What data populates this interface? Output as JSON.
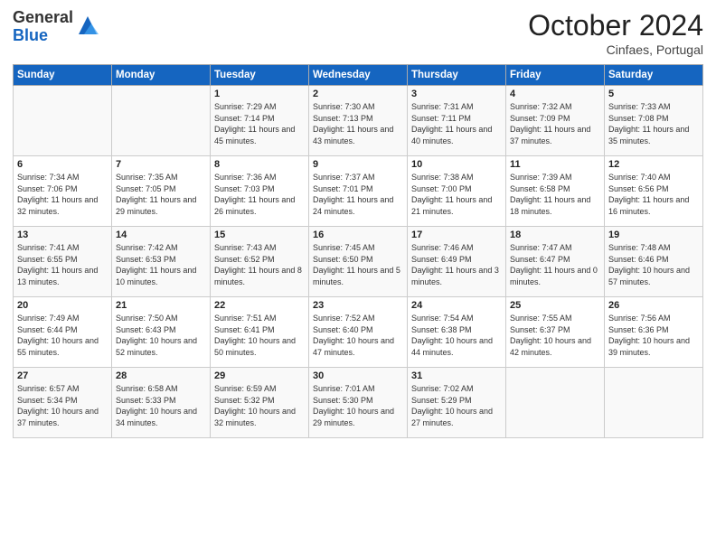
{
  "logo": {
    "general": "General",
    "blue": "Blue"
  },
  "title": "October 2024",
  "subtitle": "Cinfaes, Portugal",
  "days_header": [
    "Sunday",
    "Monday",
    "Tuesday",
    "Wednesday",
    "Thursday",
    "Friday",
    "Saturday"
  ],
  "weeks": [
    [
      {
        "day": "",
        "sunrise": "",
        "sunset": "",
        "daylight": ""
      },
      {
        "day": "",
        "sunrise": "",
        "sunset": "",
        "daylight": ""
      },
      {
        "day": "1",
        "sunrise": "Sunrise: 7:29 AM",
        "sunset": "Sunset: 7:14 PM",
        "daylight": "Daylight: 11 hours and 45 minutes."
      },
      {
        "day": "2",
        "sunrise": "Sunrise: 7:30 AM",
        "sunset": "Sunset: 7:13 PM",
        "daylight": "Daylight: 11 hours and 43 minutes."
      },
      {
        "day": "3",
        "sunrise": "Sunrise: 7:31 AM",
        "sunset": "Sunset: 7:11 PM",
        "daylight": "Daylight: 11 hours and 40 minutes."
      },
      {
        "day": "4",
        "sunrise": "Sunrise: 7:32 AM",
        "sunset": "Sunset: 7:09 PM",
        "daylight": "Daylight: 11 hours and 37 minutes."
      },
      {
        "day": "5",
        "sunrise": "Sunrise: 7:33 AM",
        "sunset": "Sunset: 7:08 PM",
        "daylight": "Daylight: 11 hours and 35 minutes."
      }
    ],
    [
      {
        "day": "6",
        "sunrise": "Sunrise: 7:34 AM",
        "sunset": "Sunset: 7:06 PM",
        "daylight": "Daylight: 11 hours and 32 minutes."
      },
      {
        "day": "7",
        "sunrise": "Sunrise: 7:35 AM",
        "sunset": "Sunset: 7:05 PM",
        "daylight": "Daylight: 11 hours and 29 minutes."
      },
      {
        "day": "8",
        "sunrise": "Sunrise: 7:36 AM",
        "sunset": "Sunset: 7:03 PM",
        "daylight": "Daylight: 11 hours and 26 minutes."
      },
      {
        "day": "9",
        "sunrise": "Sunrise: 7:37 AM",
        "sunset": "Sunset: 7:01 PM",
        "daylight": "Daylight: 11 hours and 24 minutes."
      },
      {
        "day": "10",
        "sunrise": "Sunrise: 7:38 AM",
        "sunset": "Sunset: 7:00 PM",
        "daylight": "Daylight: 11 hours and 21 minutes."
      },
      {
        "day": "11",
        "sunrise": "Sunrise: 7:39 AM",
        "sunset": "Sunset: 6:58 PM",
        "daylight": "Daylight: 11 hours and 18 minutes."
      },
      {
        "day": "12",
        "sunrise": "Sunrise: 7:40 AM",
        "sunset": "Sunset: 6:56 PM",
        "daylight": "Daylight: 11 hours and 16 minutes."
      }
    ],
    [
      {
        "day": "13",
        "sunrise": "Sunrise: 7:41 AM",
        "sunset": "Sunset: 6:55 PM",
        "daylight": "Daylight: 11 hours and 13 minutes."
      },
      {
        "day": "14",
        "sunrise": "Sunrise: 7:42 AM",
        "sunset": "Sunset: 6:53 PM",
        "daylight": "Daylight: 11 hours and 10 minutes."
      },
      {
        "day": "15",
        "sunrise": "Sunrise: 7:43 AM",
        "sunset": "Sunset: 6:52 PM",
        "daylight": "Daylight: 11 hours and 8 minutes."
      },
      {
        "day": "16",
        "sunrise": "Sunrise: 7:45 AM",
        "sunset": "Sunset: 6:50 PM",
        "daylight": "Daylight: 11 hours and 5 minutes."
      },
      {
        "day": "17",
        "sunrise": "Sunrise: 7:46 AM",
        "sunset": "Sunset: 6:49 PM",
        "daylight": "Daylight: 11 hours and 3 minutes."
      },
      {
        "day": "18",
        "sunrise": "Sunrise: 7:47 AM",
        "sunset": "Sunset: 6:47 PM",
        "daylight": "Daylight: 11 hours and 0 minutes."
      },
      {
        "day": "19",
        "sunrise": "Sunrise: 7:48 AM",
        "sunset": "Sunset: 6:46 PM",
        "daylight": "Daylight: 10 hours and 57 minutes."
      }
    ],
    [
      {
        "day": "20",
        "sunrise": "Sunrise: 7:49 AM",
        "sunset": "Sunset: 6:44 PM",
        "daylight": "Daylight: 10 hours and 55 minutes."
      },
      {
        "day": "21",
        "sunrise": "Sunrise: 7:50 AM",
        "sunset": "Sunset: 6:43 PM",
        "daylight": "Daylight: 10 hours and 52 minutes."
      },
      {
        "day": "22",
        "sunrise": "Sunrise: 7:51 AM",
        "sunset": "Sunset: 6:41 PM",
        "daylight": "Daylight: 10 hours and 50 minutes."
      },
      {
        "day": "23",
        "sunrise": "Sunrise: 7:52 AM",
        "sunset": "Sunset: 6:40 PM",
        "daylight": "Daylight: 10 hours and 47 minutes."
      },
      {
        "day": "24",
        "sunrise": "Sunrise: 7:54 AM",
        "sunset": "Sunset: 6:38 PM",
        "daylight": "Daylight: 10 hours and 44 minutes."
      },
      {
        "day": "25",
        "sunrise": "Sunrise: 7:55 AM",
        "sunset": "Sunset: 6:37 PM",
        "daylight": "Daylight: 10 hours and 42 minutes."
      },
      {
        "day": "26",
        "sunrise": "Sunrise: 7:56 AM",
        "sunset": "Sunset: 6:36 PM",
        "daylight": "Daylight: 10 hours and 39 minutes."
      }
    ],
    [
      {
        "day": "27",
        "sunrise": "Sunrise: 6:57 AM",
        "sunset": "Sunset: 5:34 PM",
        "daylight": "Daylight: 10 hours and 37 minutes."
      },
      {
        "day": "28",
        "sunrise": "Sunrise: 6:58 AM",
        "sunset": "Sunset: 5:33 PM",
        "daylight": "Daylight: 10 hours and 34 minutes."
      },
      {
        "day": "29",
        "sunrise": "Sunrise: 6:59 AM",
        "sunset": "Sunset: 5:32 PM",
        "daylight": "Daylight: 10 hours and 32 minutes."
      },
      {
        "day": "30",
        "sunrise": "Sunrise: 7:01 AM",
        "sunset": "Sunset: 5:30 PM",
        "daylight": "Daylight: 10 hours and 29 minutes."
      },
      {
        "day": "31",
        "sunrise": "Sunrise: 7:02 AM",
        "sunset": "Sunset: 5:29 PM",
        "daylight": "Daylight: 10 hours and 27 minutes."
      },
      {
        "day": "",
        "sunrise": "",
        "sunset": "",
        "daylight": ""
      },
      {
        "day": "",
        "sunrise": "",
        "sunset": "",
        "daylight": ""
      }
    ]
  ]
}
